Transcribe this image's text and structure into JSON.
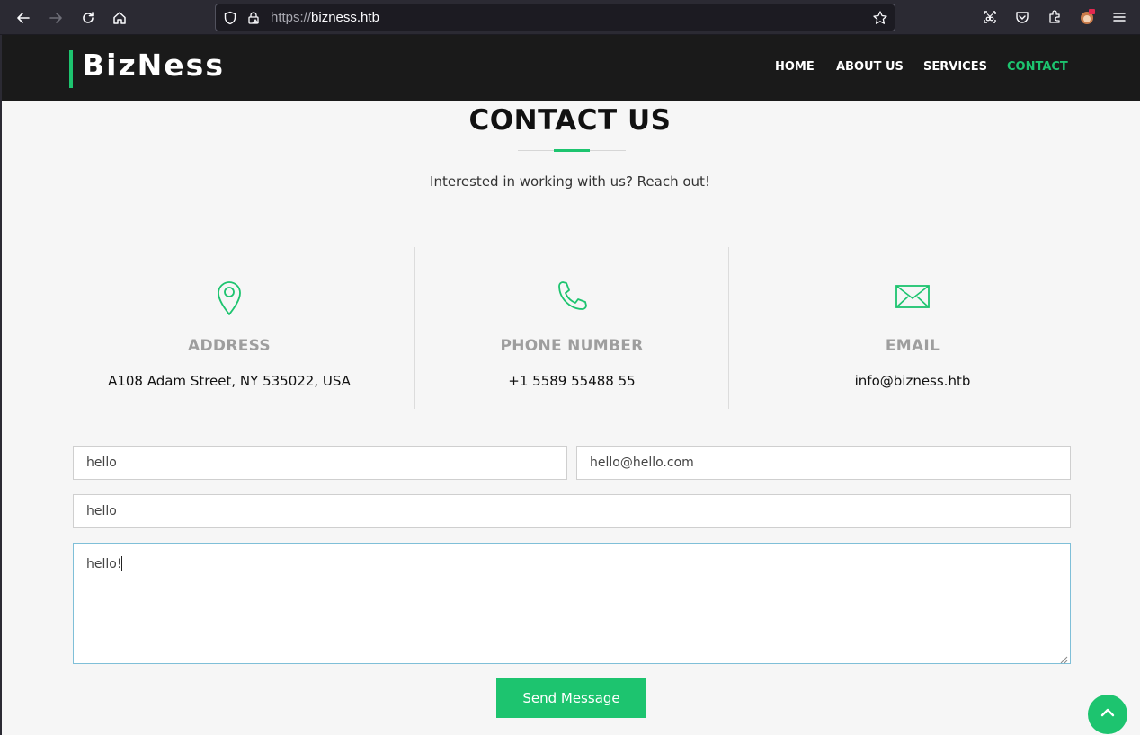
{
  "browser": {
    "url_protocol": "https://",
    "url_host": "bizness.htb",
    "icons": [
      "back-arrow-icon",
      "forward-arrow-icon",
      "reload-icon",
      "home-icon",
      "shield-icon",
      "insecure-lock-icon",
      "bookmark-star-icon",
      "screenshot-icon",
      "pocket-icon",
      "extensions-icon",
      "profile-avatar-icon",
      "hamburger-menu-icon"
    ]
  },
  "site": {
    "logo": "BizNess",
    "nav": [
      {
        "label": "HOME",
        "active": false
      },
      {
        "label": "ABOUT US",
        "active": false
      },
      {
        "label": "SERVICES",
        "active": false
      },
      {
        "label": "CONTACT",
        "active": true
      }
    ]
  },
  "contact": {
    "title": "CONTACT US",
    "subtitle": "Interested in working with us? Reach out!",
    "info": [
      {
        "icon": "map-pin-icon",
        "heading": "ADDRESS",
        "value": "A108 Adam Street, NY 535022, USA"
      },
      {
        "icon": "phone-icon",
        "heading": "PHONE NUMBER",
        "value": "+1 5589 55488 55"
      },
      {
        "icon": "envelope-icon",
        "heading": "EMAIL",
        "value": "info@bizness.htb"
      }
    ],
    "form": {
      "name_value": "hello",
      "email_value": "hello@hello.com",
      "subject_value": "hello",
      "message_value": "hello!",
      "submit_label": "Send Message"
    }
  },
  "colors": {
    "accent": "#1dc46f",
    "header_bg": "#1a1a1a",
    "page_bg": "#f6f6f6",
    "browser_bg": "#2b2a33"
  }
}
